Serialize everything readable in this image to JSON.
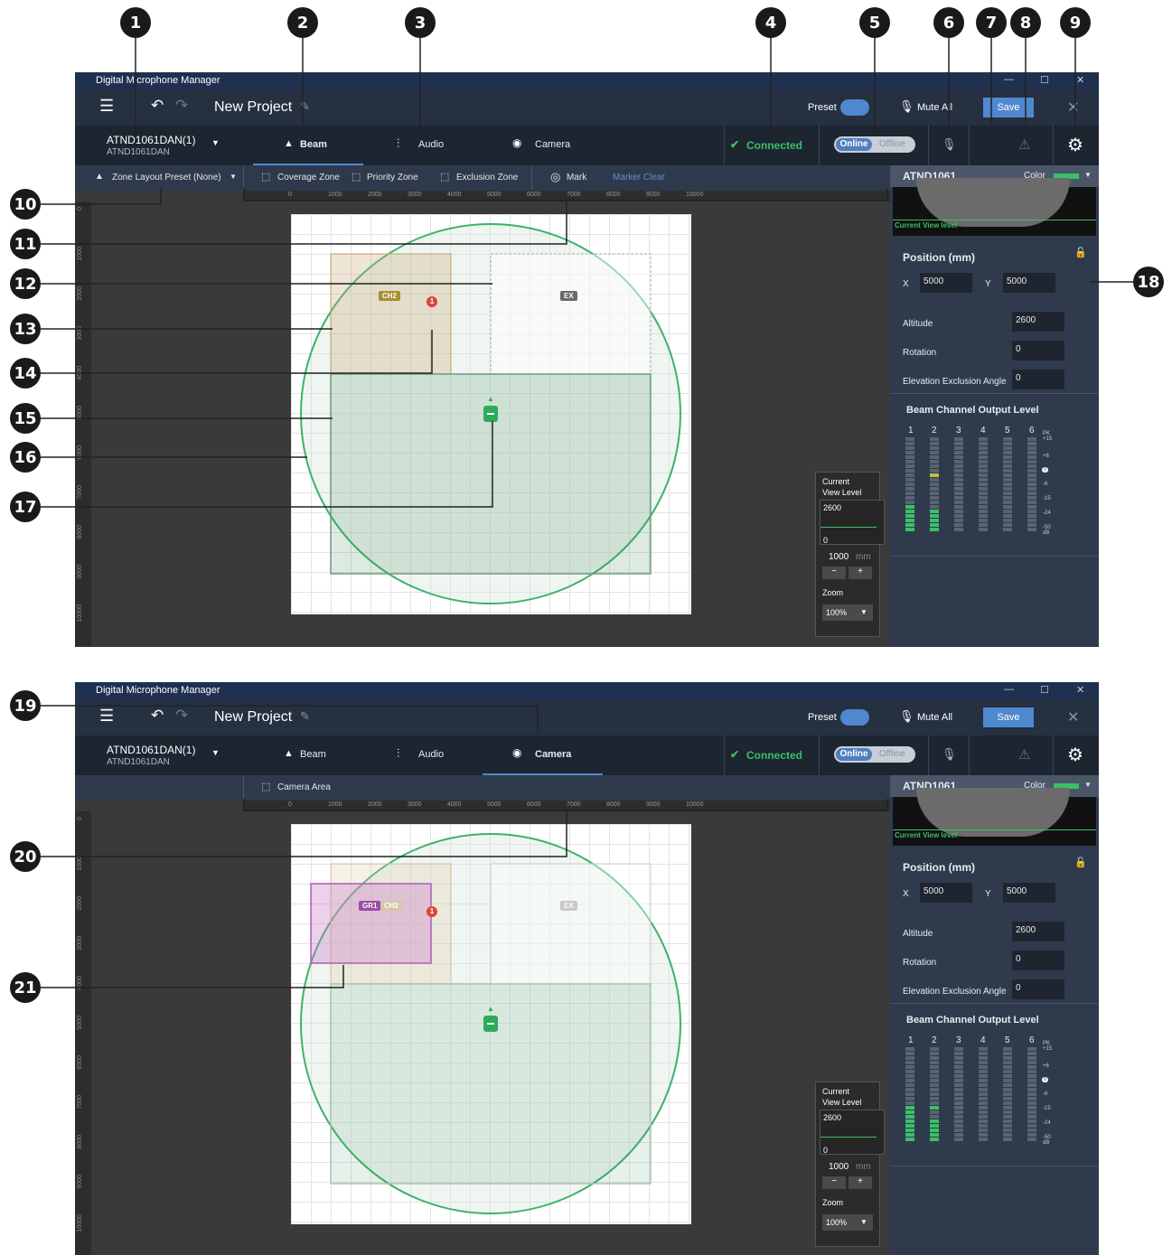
{
  "app": {
    "title": "Digital Microphone Manager",
    "project_name": "New Project",
    "preset_label": "Preset",
    "mute_all_label": "Mute All",
    "save_label": "Save"
  },
  "device": {
    "name": "ATND1061DAN(1)",
    "model": "ATND1061DAN"
  },
  "tabs": [
    "Beam",
    "Audio",
    "Camera"
  ],
  "status": {
    "connected": "Connected",
    "online": "Online",
    "offline": "Offline"
  },
  "toolbar_beam": {
    "zone_layout_preset": "Zone Layout Preset (None)",
    "coverage_zone": "Coverage Zone",
    "priority_zone": "Priority Zone",
    "exclusion_zone": "Exclusion Zone",
    "mark": "Mark",
    "marker_clear": "Marker Clear"
  },
  "toolbar_camera": {
    "camera_area": "Camera Area"
  },
  "ruler": {
    "x_ticks": [
      "0",
      "1000",
      "2000",
      "3000",
      "4000",
      "5000",
      "6000",
      "7000",
      "8000",
      "9000",
      "10000"
    ],
    "y_ticks": [
      "0",
      "1000",
      "2000",
      "3000",
      "4000",
      "5000",
      "6000",
      "7000",
      "8000",
      "9000",
      "10000"
    ]
  },
  "canvas_labels": {
    "ch2": "CH2",
    "ex": "EX",
    "gr1": "GR1",
    "marker": "1"
  },
  "view_panel": {
    "title_line1": "Current",
    "title_line2": "View Level",
    "max": "2600",
    "min": "0",
    "step": "1000",
    "unit": "mm",
    "minus": "−",
    "plus": "+",
    "zoom_label": "Zoom",
    "zoom_value": "100%"
  },
  "right_panel": {
    "device": "ATND1061",
    "color_label": "Color",
    "color_value": "#3bbf68",
    "current_view_level": "Current View level",
    "position_title": "Position (mm)",
    "x_label": "X",
    "x_value": "5000",
    "y_label": "Y",
    "y_value": "5000",
    "altitude_label": "Altitude",
    "altitude_value": "2600",
    "rotation_label": "Rotation",
    "rotation_value": "0",
    "elev_label": "Elevation Exclusion Angle",
    "elev_value": "0",
    "beam_title": "Beam Channel Output Level",
    "channels": [
      "1",
      "2",
      "3",
      "4",
      "5",
      "6"
    ],
    "scale": [
      "PK\n+15",
      "+6",
      "0",
      "-6",
      "-15",
      "-24",
      "-50\ndB"
    ]
  },
  "callouts": [
    "1",
    "2",
    "3",
    "4",
    "5",
    "6",
    "7",
    "8",
    "9",
    "10",
    "11",
    "12",
    "13",
    "14",
    "15",
    "16",
    "17",
    "18",
    "19",
    "20",
    "21"
  ]
}
